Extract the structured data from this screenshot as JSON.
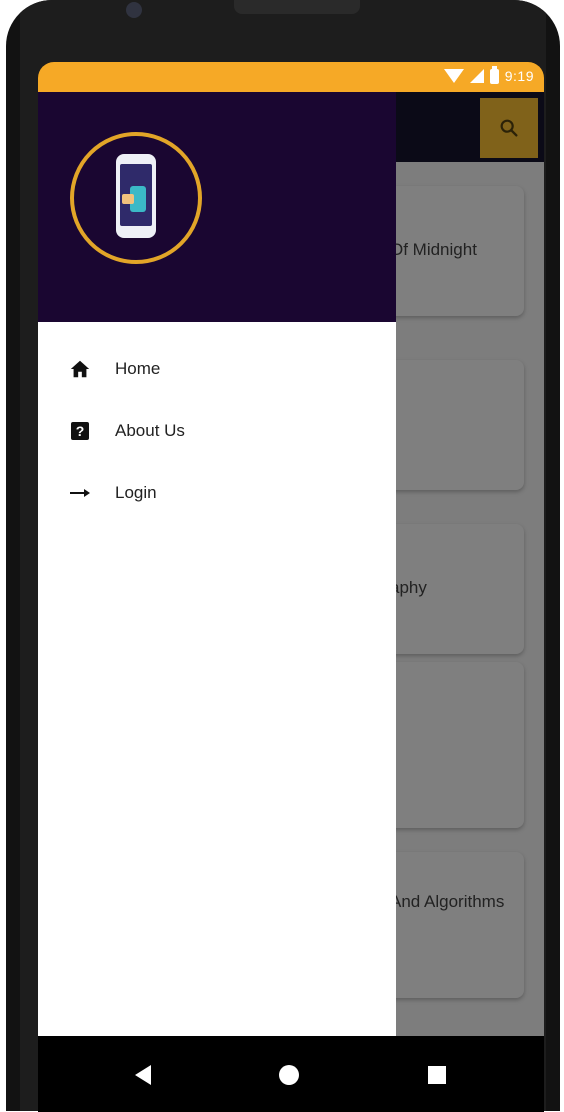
{
  "status_bar": {
    "time": "9:19",
    "background_color": "#f6a926"
  },
  "background_app": {
    "card_texts": [
      "Of Midnight",
      "aphy",
      "And Algorithms"
    ],
    "search_icon": "search-icon"
  },
  "drawer": {
    "header_color": "#1a0631",
    "logo_icon": "phone-logo",
    "items": [
      {
        "label": "Home",
        "icon": "home-icon"
      },
      {
        "label": "About Us",
        "icon": "help-icon"
      },
      {
        "label": "Login",
        "icon": "arrow-right-icon"
      }
    ]
  },
  "nav": {
    "back_icon": "back-icon",
    "home_icon": "home-circle-icon",
    "recents_icon": "recents-icon"
  }
}
